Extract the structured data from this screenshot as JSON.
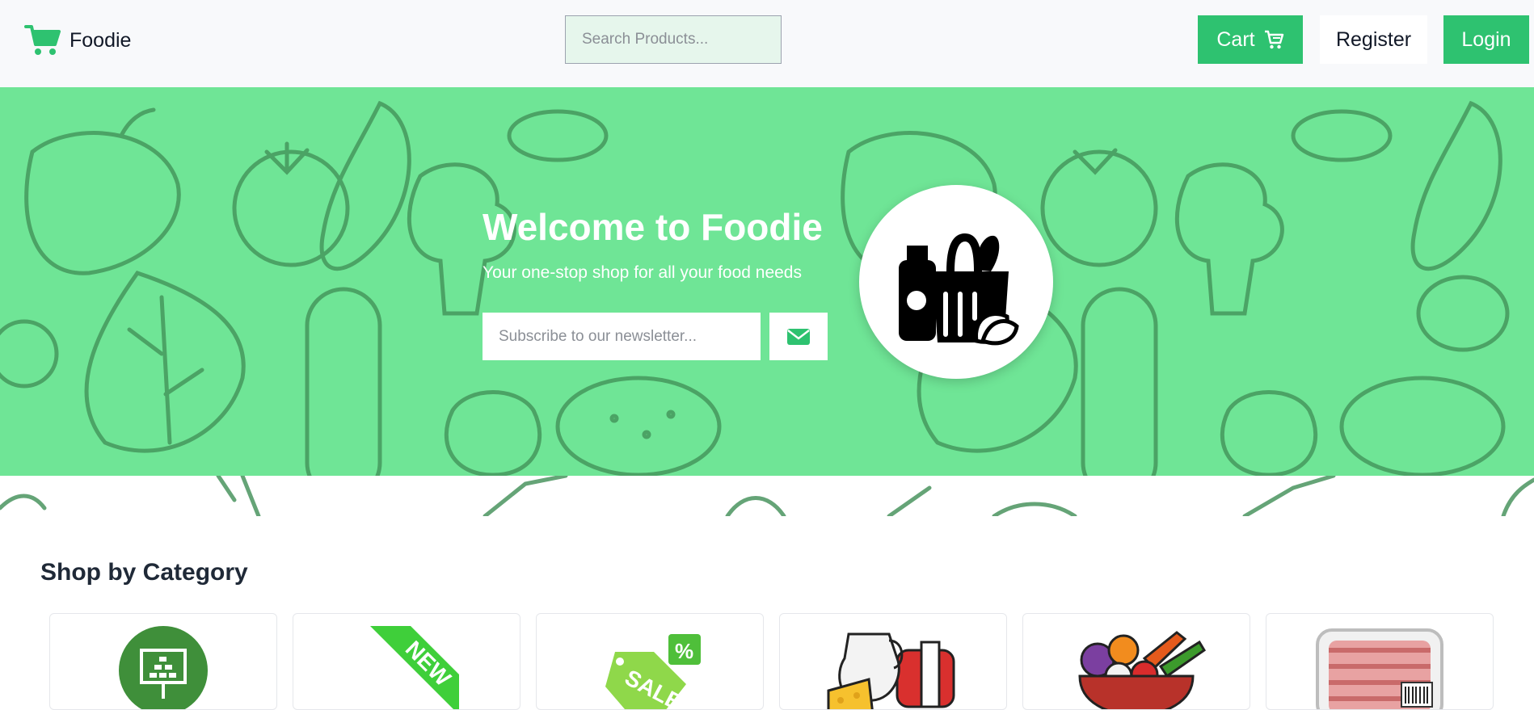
{
  "header": {
    "brand": {
      "name": "Foodie",
      "icon": "shopping-cart-icon"
    },
    "search": {
      "placeholder": "Search Products..."
    },
    "cart_label": "Cart",
    "register_label": "Register",
    "login_label": "Login"
  },
  "hero": {
    "title": "Welcome to Foodie",
    "subtitle": "Your one-stop shop for all your food needs",
    "newsletter_placeholder": "Subscribe to our newsletter...",
    "subscribe_icon": "envelope-icon",
    "logo_icon": "grocery-bag-icon"
  },
  "categories": {
    "title": "Shop by Category",
    "items": [
      {
        "icon": "catalog-board-icon"
      },
      {
        "icon": "new-ribbon-icon"
      },
      {
        "icon": "sale-tag-icon"
      },
      {
        "icon": "dairy-icon"
      },
      {
        "icon": "vegetable-bowl-icon"
      },
      {
        "icon": "meat-package-icon"
      }
    ]
  },
  "colors": {
    "accent": "#2ec270",
    "hero_bg": "#6fe596",
    "header_bg": "#f8f9fb",
    "search_bg": "#e6f6ec"
  }
}
